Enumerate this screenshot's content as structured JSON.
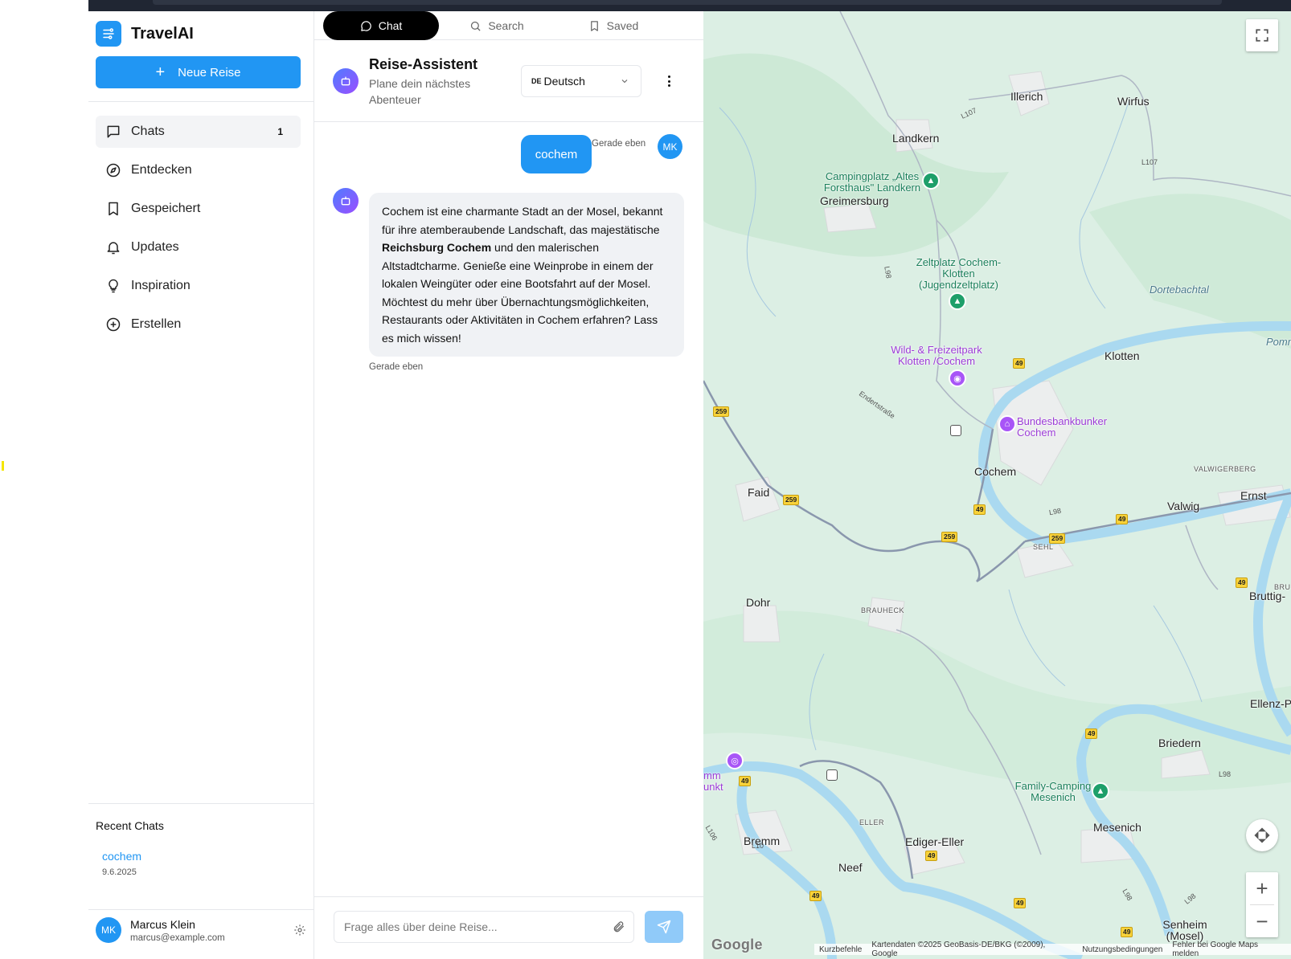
{
  "sidebar": {
    "app_name": "TravelAI",
    "new_trip_label": "Neue Reise",
    "nav": [
      {
        "label": "Chats",
        "badge": "1"
      },
      {
        "label": "Entdecken"
      },
      {
        "label": "Gespeichert"
      },
      {
        "label": "Updates"
      },
      {
        "label": "Inspiration"
      },
      {
        "label": "Erstellen"
      }
    ],
    "recent_title": "Recent Chats",
    "recent": [
      {
        "name": "cochem",
        "date": "9.6.2025"
      }
    ],
    "user": {
      "initials": "MK",
      "name": "Marcus Klein",
      "email": "marcus@example.com"
    }
  },
  "tabs": [
    {
      "label": "Chat",
      "active": true
    },
    {
      "label": "Search"
    },
    {
      "label": "Saved"
    }
  ],
  "chat_header": {
    "title": "Reise-Assistent",
    "subtitle": "Plane dein nächstes Abenteuer",
    "language_code": "DE",
    "language": "Deutsch"
  },
  "messages": {
    "user_text": "cochem",
    "user_time": "Gerade eben",
    "user_initials": "MK",
    "bot_part1": "Cochem ist eine charmante Stadt an der Mosel, bekannt für ihre atemberaubende Landschaft, das majestätische ",
    "bot_bold": "Reichsburg Cochem",
    "bot_part2": " und den malerischen Altstadtcharme. Genieße eine Weinprobe in einem der lokalen Weingüter oder eine Bootsfahrt auf der Mosel. Möchtest du mehr über Übernachtungsmöglichkeiten, Restaurants oder Aktivitäten in Cochem erfahren? Lass es mich wissen!",
    "bot_time": "Gerade eben"
  },
  "input": {
    "placeholder": "Frage alles über deine Reise..."
  },
  "map": {
    "places": [
      "Illerich",
      "Wirfus",
      "Landkern",
      "Greimersburg",
      "Klotten",
      "Cochem",
      "Faid",
      "Valwig",
      "Ernst",
      "Dohr",
      "Bruttig-",
      "Ellenz-P",
      "Briedern",
      "Mesenich",
      "Bremm",
      "Neef",
      "Ediger-Eller",
      "Senheim (Mosel)",
      "mm unkt"
    ],
    "small_places": [
      "VALWIGERBERG",
      "SEHL",
      "BRAUHECK",
      "ELLER",
      "BRU"
    ],
    "water": [
      "Dortebachtal",
      "Pomm"
    ],
    "pois_green": [
      "Campingplatz „Altes Forsthaus\" Landkern",
      "Zeltplatz Cochem-Klotten (Jugendzeltplatz)",
      "Family-Camping Mesenich"
    ],
    "pois_purple": [
      "Wild- & Freizeitpark Klotten /Cochem",
      "Bundesbankbunker Cochem"
    ],
    "road_shields": [
      "49",
      "259",
      "259",
      "259",
      "49",
      "49",
      "259",
      "49",
      "49",
      "49",
      "49",
      "49",
      "49",
      "49"
    ],
    "road_labels": [
      "L107",
      "L107",
      "L98",
      "L98",
      "L98",
      "L98",
      "L106",
      "L10",
      "L98",
      "Endertstraße"
    ],
    "attribution": [
      "Kurzbefehle",
      "Kartendaten ©2025 GeoBasis-DE/BKG (©2009), Google",
      "Nutzungsbedingungen",
      "Fehler bei Google Maps melden"
    ],
    "logo": "Google",
    "colors": {
      "land": "#dcefe4",
      "river": "#aad9f0",
      "road": "#7a8aa6"
    }
  },
  "colors": {
    "accent": "#2196f3",
    "send_disabled": "#90caf9"
  }
}
